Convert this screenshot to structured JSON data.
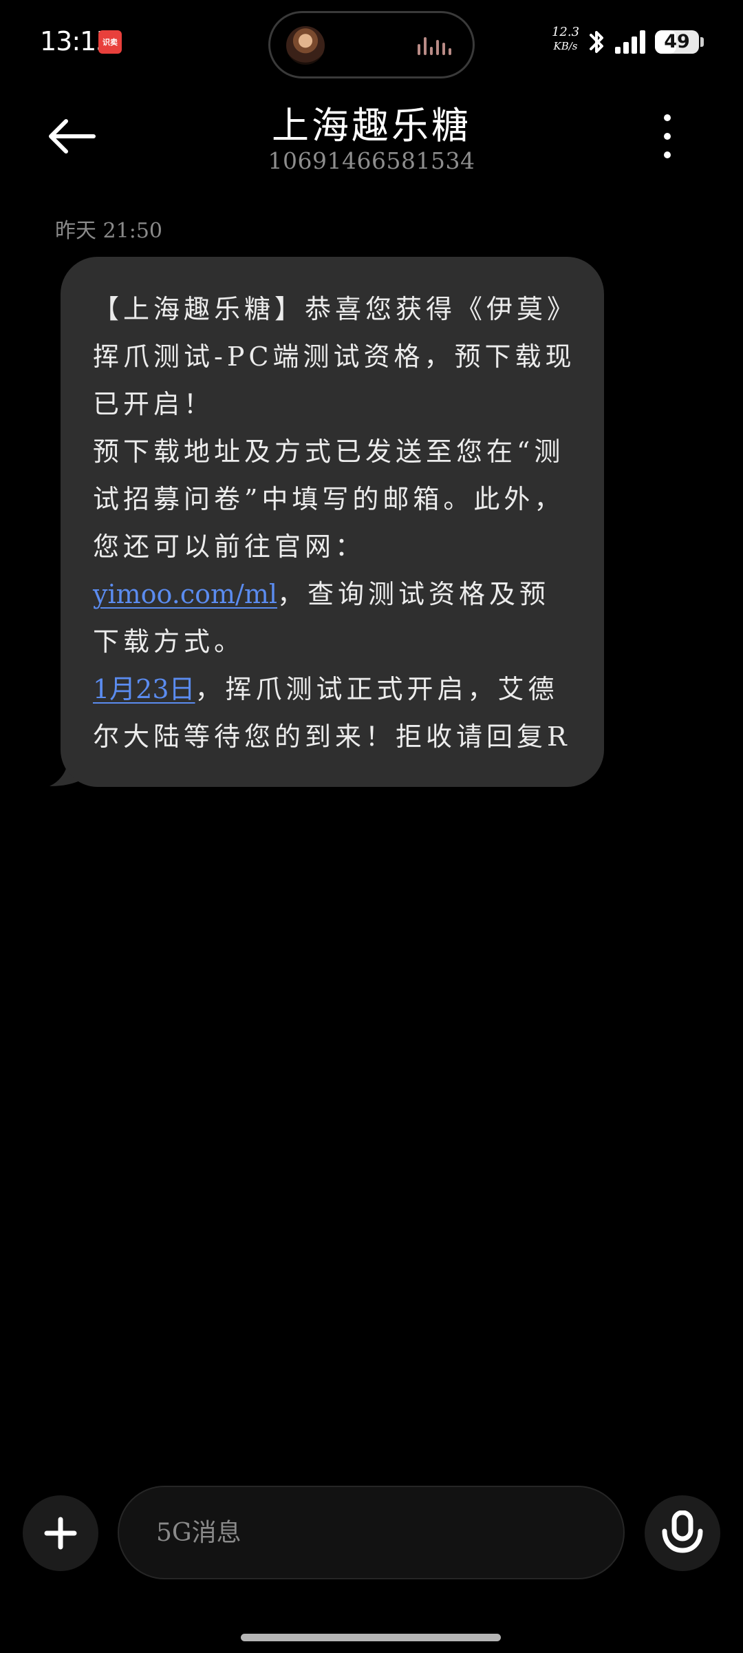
{
  "status_bar": {
    "time": "13:15",
    "badge_text": "识卖",
    "network_speed_value": "12.3",
    "network_speed_unit": "KB/s",
    "battery_level": "49",
    "battery_fraction": 0.49
  },
  "header": {
    "title": "上海趣乐糖",
    "subtitle": "10691466581534"
  },
  "conversation": {
    "timestamp": "昨天 21:50",
    "message": {
      "part1": "【上海趣乐糖】恭喜您获得《伊莫》挥爪测试-PC端测试资格，预下载现已开启！",
      "part2": "预下载地址及方式已发送至您在“测试招募问卷”中填写的邮箱。此外，您还可以前往官网：",
      "link_url": "yimoo.com/ml",
      "part3": "，查询测试资格及预下载方式。",
      "link_date": "1月23日",
      "part4": "，挥爪测试正式开启，艾德尔大陆等待您的到来！拒收请回复R"
    }
  },
  "composer": {
    "placeholder": "5G消息"
  },
  "colors": {
    "background": "#000000",
    "bubble": "#2f2f2f",
    "link": "#5b8cf0",
    "badge": "#e8403c",
    "secondary_text": "#8e8e8e"
  },
  "icons": {
    "back": "arrow-left-icon",
    "more": "more-vertical-icon",
    "add": "plus-icon",
    "mic": "microphone-icon",
    "bluetooth": "bluetooth-icon",
    "signal": "signal-icon",
    "battery": "battery-icon"
  }
}
